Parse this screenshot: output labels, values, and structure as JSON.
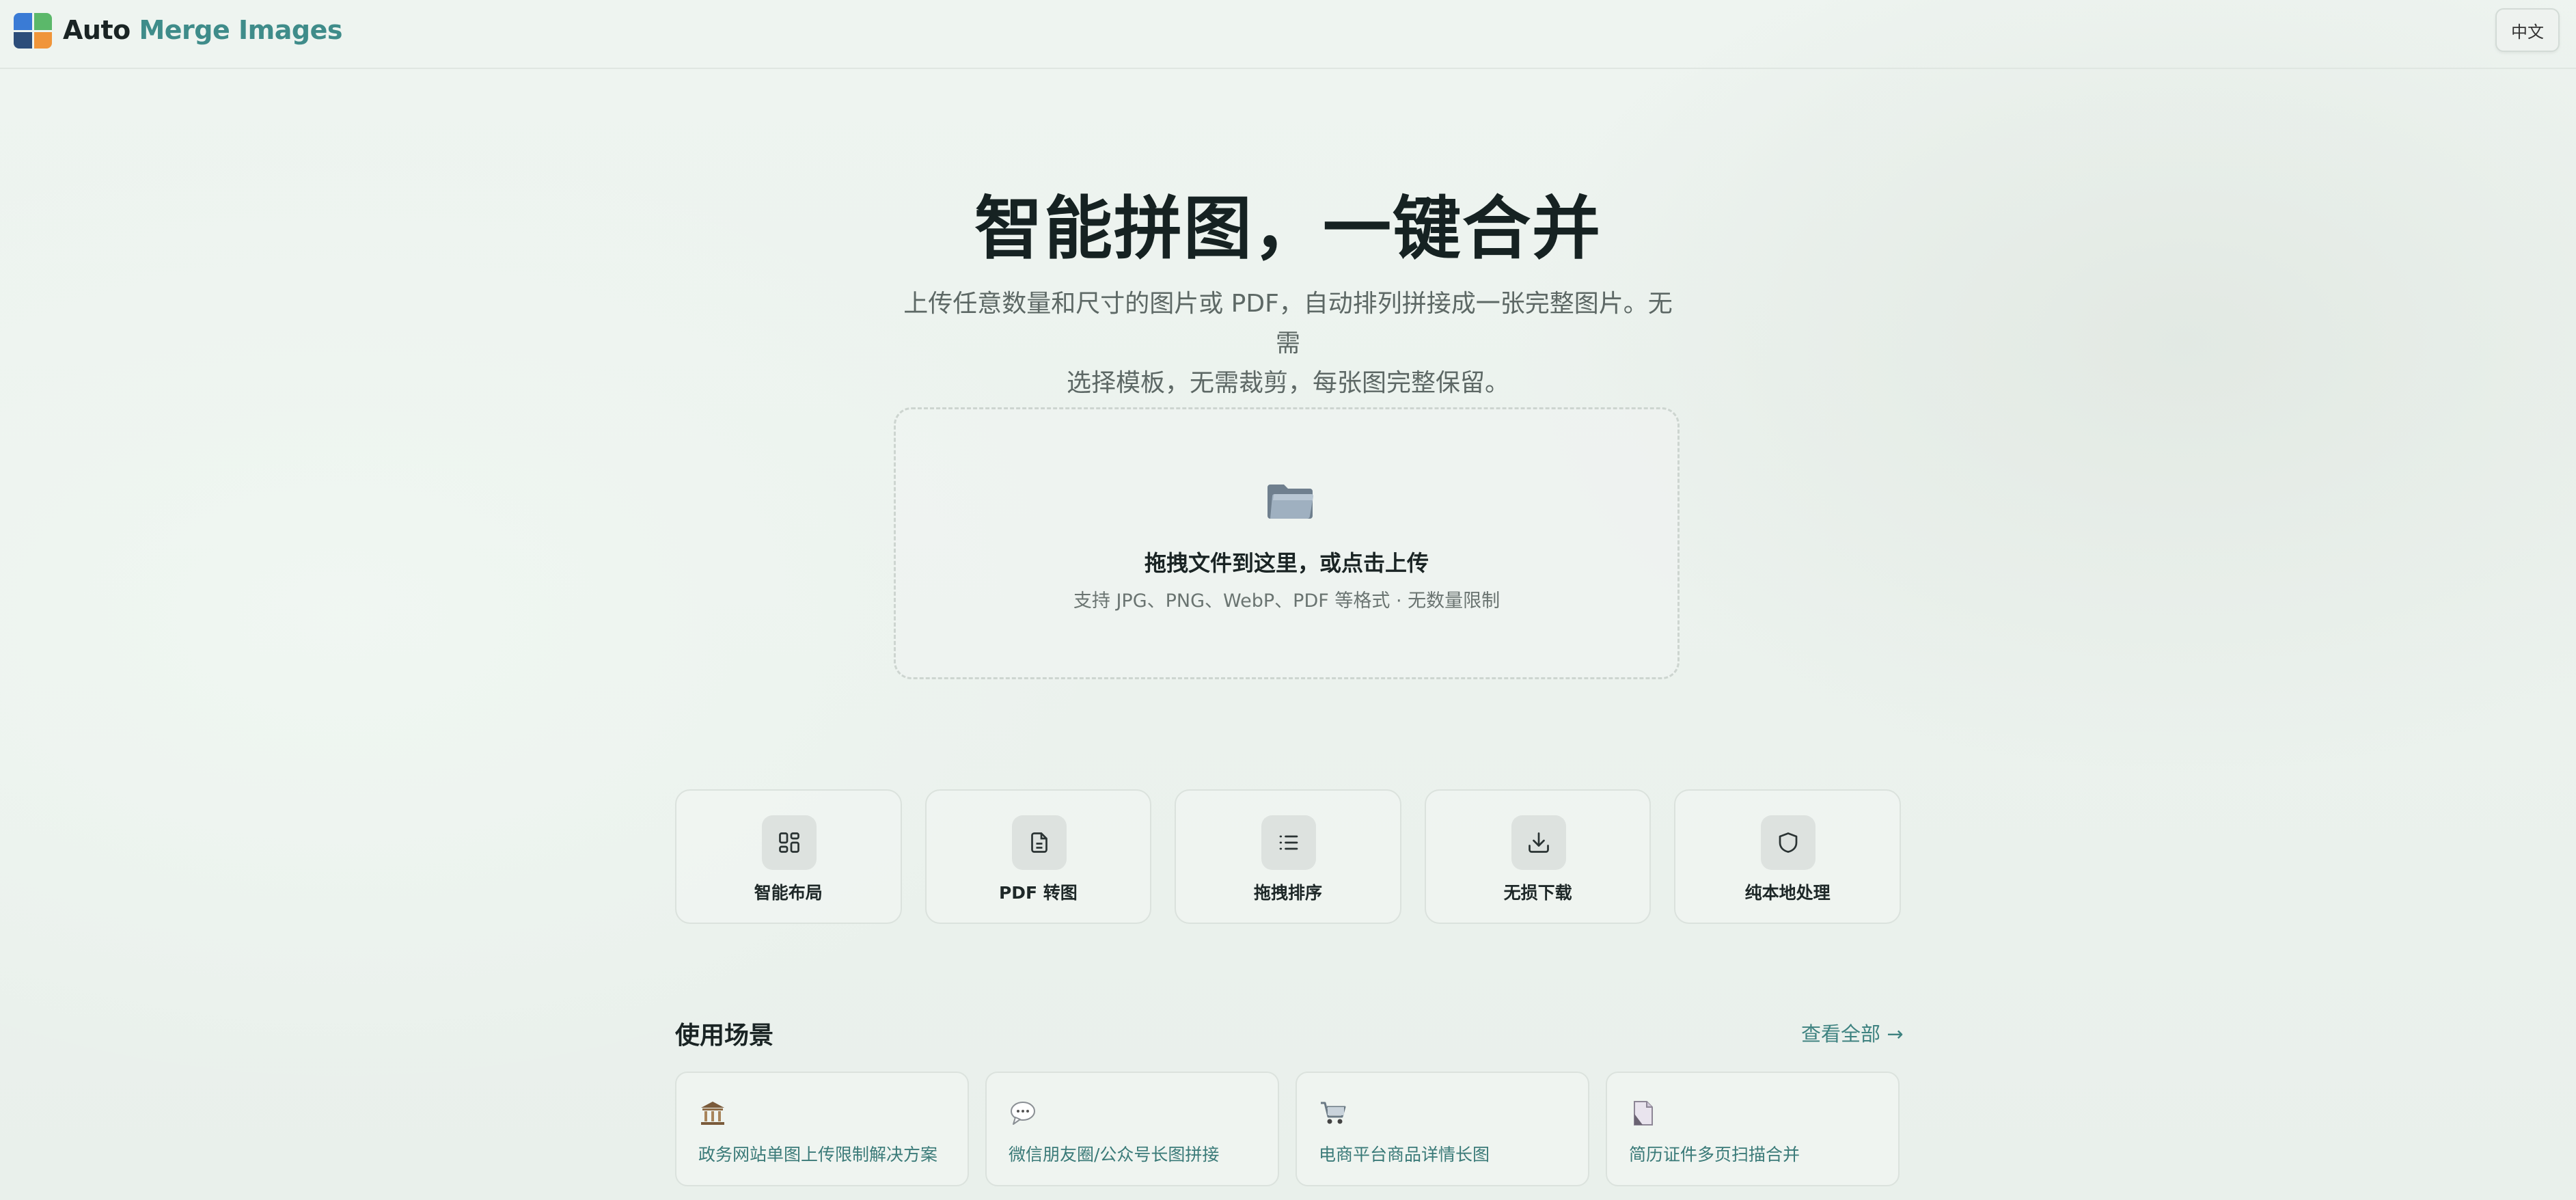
{
  "header": {
    "brand_part1": "Auto",
    "brand_part2": " Merge Images",
    "lang_button": "中文"
  },
  "hero": {
    "title": "智能拼图，一键合并",
    "subtitle_line1": "上传任意数量和尺寸的图片或 PDF，自动排列拼接成一张完整图片。无需",
    "subtitle_line2": "选择模板，无需裁剪，每张图完整保留。"
  },
  "upload": {
    "icon": "folder-icon",
    "title": "拖拽文件到这里，或点击上传",
    "hint": "支持 JPG、PNG、WebP、PDF 等格式 · 无数量限制"
  },
  "features": [
    {
      "label": "智能布局",
      "icon": "grid-layout-icon"
    },
    {
      "label": "PDF 转图",
      "icon": "document-icon"
    },
    {
      "label": "拖拽排序",
      "icon": "list-icon"
    },
    {
      "label": "无损下载",
      "icon": "download-icon"
    },
    {
      "label": "纯本地处理",
      "icon": "shield-icon"
    }
  ],
  "scenarios_section": {
    "title": "使用场景",
    "view_all": "查看全部 →",
    "items": [
      {
        "label": "政务网站单图上传限制解决方案",
        "icon": "government-building-icon"
      },
      {
        "label": "微信朋友圈/公众号长图拼接",
        "icon": "chat-bubble-icon"
      },
      {
        "label": "电商平台商品详情长图",
        "icon": "shopping-cart-icon"
      },
      {
        "label": "简历证件多页扫描合并",
        "icon": "page-icon"
      }
    ]
  },
  "colors": {
    "accent": "#3f8c8a",
    "text_primary": "#1a2424",
    "text_secondary": "#5d6865"
  }
}
